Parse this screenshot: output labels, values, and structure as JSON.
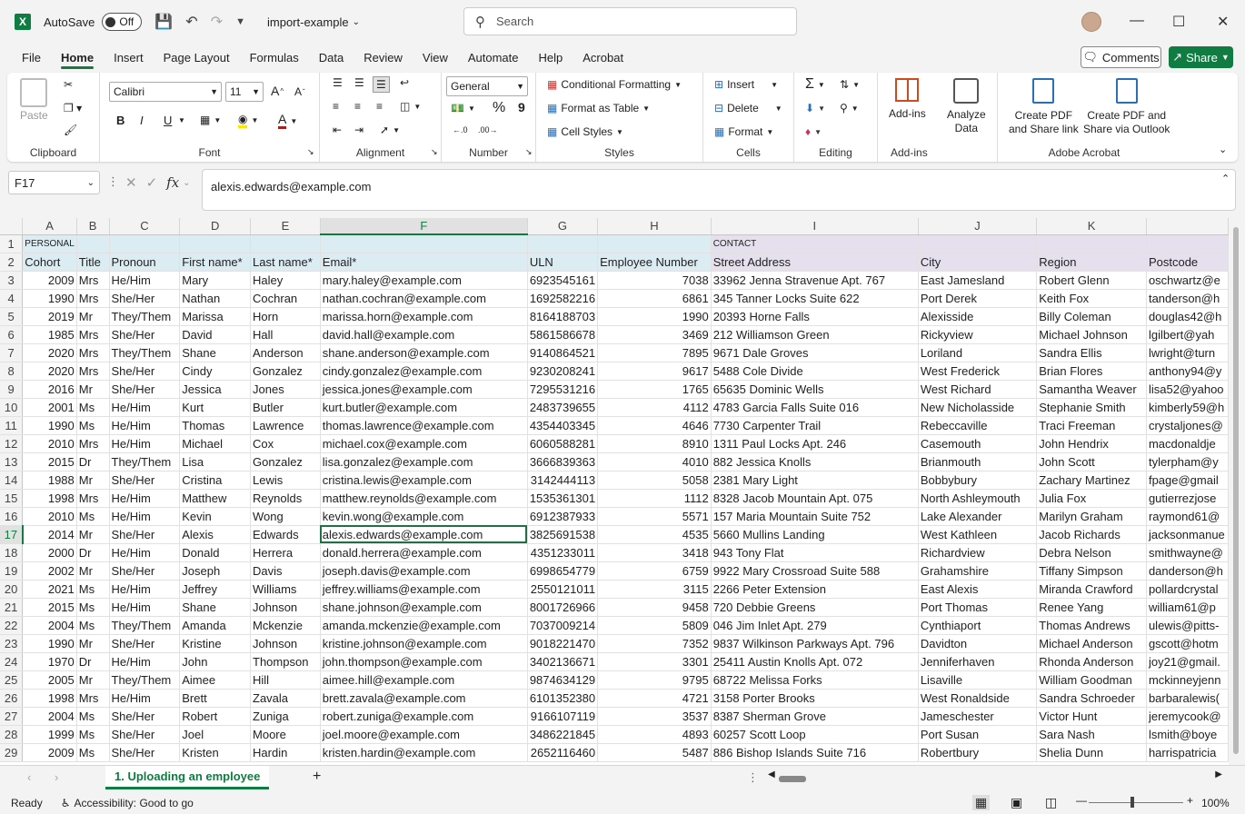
{
  "app": {
    "autosave_label": "AutoSave",
    "autosave_state": "Off",
    "doc_name": "import-example",
    "search_placeholder": "Search",
    "logo": "X"
  },
  "menu": [
    "File",
    "Home",
    "Insert",
    "Page Layout",
    "Formulas",
    "Data",
    "Review",
    "View",
    "Automate",
    "Help",
    "Acrobat"
  ],
  "comments_label": "Comments",
  "share_label": "Share",
  "ribbon": {
    "clipboard": {
      "label": "Clipboard",
      "paste": "Paste"
    },
    "font": {
      "label": "Font",
      "family": "Calibri",
      "size": "11",
      "bold": "B",
      "italic": "I",
      "underline": "U",
      "grow": "A",
      "shrink": "A",
      "color_letter": "A"
    },
    "alignment": {
      "label": "Alignment"
    },
    "number": {
      "label": "Number",
      "format": "General",
      "percent": "%",
      "comma": "9"
    },
    "styles": {
      "label": "Styles",
      "conditional": "Conditional Formatting",
      "format_table": "Format as Table",
      "cell_styles": "Cell Styles"
    },
    "cells": {
      "label": "Cells",
      "insert": "Insert",
      "delete": "Delete",
      "format": "Format"
    },
    "editing": {
      "label": "Editing"
    },
    "addins": {
      "label": "Add-ins",
      "addins": "Add-ins",
      "analyze": "Analyze",
      "analyze2": "Data"
    },
    "acrobat": {
      "label": "Adobe Acrobat",
      "pdf1a": "Create PDF",
      "pdf1b": "and Share link",
      "pdf2a": "Create PDF and",
      "pdf2b": "Share via Outlook"
    }
  },
  "formula": {
    "namebox": "F17",
    "value": "alexis.edwards@example.com",
    "fx": "fx"
  },
  "columns": [
    "A",
    "B",
    "C",
    "D",
    "E",
    "F",
    "G",
    "H",
    "I",
    "J",
    "K"
  ],
  "section_row": [
    "PERSONAL",
    "",
    "",
    "",
    "",
    "",
    "",
    "",
    "CONTACT",
    "",
    ""
  ],
  "headers": [
    "Cohort",
    "Title",
    "Pronoun",
    "First name*",
    "Last name*",
    "Email*",
    "ULN",
    "Employee Number",
    "Street Address",
    "City",
    "Region",
    "Postcode"
  ],
  "rows": [
    [
      "2009",
      "Mrs",
      "He/Him",
      "Mary",
      "Haley",
      "mary.haley@example.com",
      "6923545161",
      "7038",
      "33962 Jenna Stravenue Apt. 767",
      "East Jamesland",
      "Robert Glenn",
      "oschwartz@e"
    ],
    [
      "1990",
      "Mrs",
      "She/Her",
      "Nathan",
      "Cochran",
      "nathan.cochran@example.com",
      "1692582216",
      "6861",
      "345 Tanner Locks Suite 622",
      "Port Derek",
      "Keith Fox",
      "tanderson@h"
    ],
    [
      "2019",
      "Mr",
      "They/Them",
      "Marissa",
      "Horn",
      "marissa.horn@example.com",
      "8164188703",
      "1990",
      "20393 Horne Falls",
      "Alexisside",
      "Billy Coleman",
      "douglas42@h"
    ],
    [
      "1985",
      "Mrs",
      "She/Her",
      "David",
      "Hall",
      "david.hall@example.com",
      "5861586678",
      "3469",
      "212 Williamson Green",
      "Rickyview",
      "Michael Johnson",
      "lgilbert@yah"
    ],
    [
      "2020",
      "Mrs",
      "They/Them",
      "Shane",
      "Anderson",
      "shane.anderson@example.com",
      "9140864521",
      "7895",
      "9671 Dale Groves",
      "Loriland",
      "Sandra Ellis",
      "lwright@turn"
    ],
    [
      "2020",
      "Mrs",
      "She/Her",
      "Cindy",
      "Gonzalez",
      "cindy.gonzalez@example.com",
      "9230208241",
      "9617",
      "5488 Cole Divide",
      "West Frederick",
      "Brian Flores",
      "anthony94@y"
    ],
    [
      "2016",
      "Mr",
      "She/Her",
      "Jessica",
      "Jones",
      "jessica.jones@example.com",
      "7295531216",
      "1765",
      "65635 Dominic Wells",
      "West Richard",
      "Samantha Weaver",
      "lisa52@yahoo"
    ],
    [
      "2001",
      "Ms",
      "He/Him",
      "Kurt",
      "Butler",
      "kurt.butler@example.com",
      "2483739655",
      "4112",
      "4783 Garcia Falls Suite 016",
      "New Nicholasside",
      "Stephanie Smith",
      "kimberly59@h"
    ],
    [
      "1990",
      "Ms",
      "He/Him",
      "Thomas",
      "Lawrence",
      "thomas.lawrence@example.com",
      "4354403345",
      "4646",
      "7730 Carpenter Trail",
      "Rebeccaville",
      "Traci Freeman",
      "crystaljones@"
    ],
    [
      "2010",
      "Mrs",
      "He/Him",
      "Michael",
      "Cox",
      "michael.cox@example.com",
      "6060588281",
      "8910",
      "1311 Paul Locks Apt. 246",
      "Casemouth",
      "John Hendrix",
      "macdonaldje"
    ],
    [
      "2015",
      "Dr",
      "They/Them",
      "Lisa",
      "Gonzalez",
      "lisa.gonzalez@example.com",
      "3666839363",
      "4010",
      "882 Jessica Knolls",
      "Brianmouth",
      "John Scott",
      "tylerpham@y"
    ],
    [
      "1988",
      "Mr",
      "She/Her",
      "Cristina",
      "Lewis",
      "cristina.lewis@example.com",
      "3142444113",
      "5058",
      "2381 Mary Light",
      "Bobbybury",
      "Zachary Martinez",
      "fpage@gmail"
    ],
    [
      "1998",
      "Mrs",
      "He/Him",
      "Matthew",
      "Reynolds",
      "matthew.reynolds@example.com",
      "1535361301",
      "1112",
      "8328 Jacob Mountain Apt. 075",
      "North Ashleymouth",
      "Julia Fox",
      "gutierrezjose"
    ],
    [
      "2010",
      "Ms",
      "He/Him",
      "Kevin",
      "Wong",
      "kevin.wong@example.com",
      "6912387933",
      "5571",
      "157 Maria Mountain Suite 752",
      "Lake Alexander",
      "Marilyn Graham",
      "raymond61@"
    ],
    [
      "2014",
      "Mr",
      "She/Her",
      "Alexis",
      "Edwards",
      "alexis.edwards@example.com",
      "3825691538",
      "4535",
      "5660 Mullins Landing",
      "West Kathleen",
      "Jacob Richards",
      "jacksonmanue"
    ],
    [
      "2000",
      "Dr",
      "He/Him",
      "Donald",
      "Herrera",
      "donald.herrera@example.com",
      "4351233011",
      "3418",
      "943 Tony Flat",
      "Richardview",
      "Debra Nelson",
      "smithwayne@"
    ],
    [
      "2002",
      "Mr",
      "She/Her",
      "Joseph",
      "Davis",
      "joseph.davis@example.com",
      "6998654779",
      "6759",
      "9922 Mary Crossroad Suite 588",
      "Grahamshire",
      "Tiffany Simpson",
      "danderson@h"
    ],
    [
      "2021",
      "Ms",
      "He/Him",
      "Jeffrey",
      "Williams",
      "jeffrey.williams@example.com",
      "2550121011",
      "3115",
      "2266 Peter Extension",
      "East Alexis",
      "Miranda Crawford",
      "pollardcrystal"
    ],
    [
      "2015",
      "Ms",
      "He/Him",
      "Shane",
      "Johnson",
      "shane.johnson@example.com",
      "8001726966",
      "9458",
      "720 Debbie Greens",
      "Port Thomas",
      "Renee Yang",
      "william61@p"
    ],
    [
      "2004",
      "Ms",
      "They/Them",
      "Amanda",
      "Mckenzie",
      "amanda.mckenzie@example.com",
      "7037009214",
      "5809",
      "046 Jim Inlet Apt. 279",
      "Cynthiaport",
      "Thomas Andrews",
      "ulewis@pitts-"
    ],
    [
      "1990",
      "Mr",
      "She/Her",
      "Kristine",
      "Johnson",
      "kristine.johnson@example.com",
      "9018221470",
      "7352",
      "9837 Wilkinson Parkways Apt. 796",
      "Davidton",
      "Michael Anderson",
      "gscott@hotm"
    ],
    [
      "1970",
      "Dr",
      "He/Him",
      "John",
      "Thompson",
      "john.thompson@example.com",
      "3402136671",
      "3301",
      "25411 Austin Knolls Apt. 072",
      "Jenniferhaven",
      "Rhonda Anderson",
      "joy21@gmail."
    ],
    [
      "2005",
      "Mr",
      "They/Them",
      "Aimee",
      "Hill",
      "aimee.hill@example.com",
      "9874634129",
      "9795",
      "68722 Melissa Forks",
      "Lisaville",
      "William Goodman",
      "mckinneyjenn"
    ],
    [
      "1998",
      "Mrs",
      "He/Him",
      "Brett",
      "Zavala",
      "brett.zavala@example.com",
      "6101352380",
      "4721",
      "3158 Porter Brooks",
      "West Ronaldside",
      "Sandra Schroeder",
      "barbaralewis("
    ],
    [
      "2004",
      "Ms",
      "She/Her",
      "Robert",
      "Zuniga",
      "robert.zuniga@example.com",
      "9166107119",
      "3537",
      "8387 Sherman Grove",
      "Jameschester",
      "Victor Hunt",
      "jeremycook@"
    ],
    [
      "1999",
      "Ms",
      "She/Her",
      "Joel",
      "Moore",
      "joel.moore@example.com",
      "3486221845",
      "4893",
      "60257 Scott Loop",
      "Port Susan",
      "Sara Nash",
      "lsmith@boye"
    ],
    [
      "2009",
      "Ms",
      "She/Her",
      "Kristen",
      "Hardin",
      "kristen.hardin@example.com",
      "2652116460",
      "5487",
      "886 Bishop Islands Suite 716",
      "Robertbury",
      "Shelia Dunn",
      "harrispatricia"
    ]
  ],
  "sheet_tab": "1. Uploading an employee",
  "status": {
    "ready": "Ready",
    "accessibility": "Accessibility: Good to go",
    "zoom": "100%"
  },
  "colors": {
    "accent": "#107c41",
    "personal": "#dcecf3",
    "contact": "#e6e0ee"
  }
}
